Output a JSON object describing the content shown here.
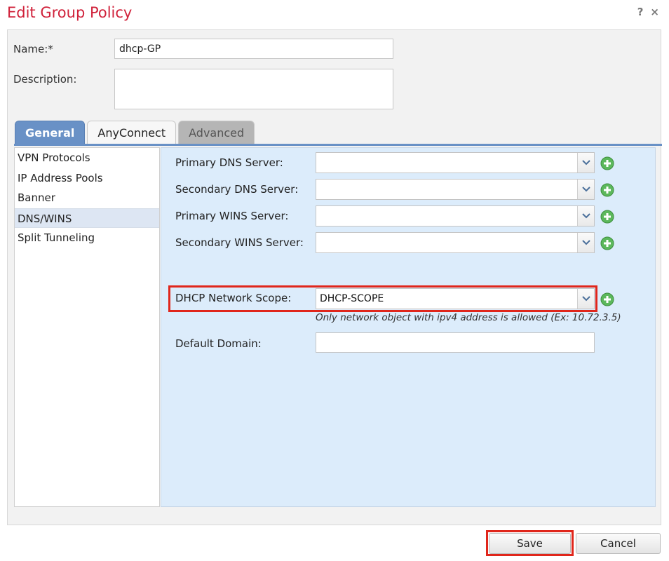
{
  "dialog": {
    "title": "Edit Group Policy",
    "help_glyph": "?",
    "close_glyph": "×"
  },
  "form": {
    "name_label": "Name:*",
    "name_value": "dhcp-GP",
    "description_label": "Description:",
    "description_value": ""
  },
  "tabs": [
    {
      "label": "General",
      "state": "active"
    },
    {
      "label": "AnyConnect",
      "state": "inactive"
    },
    {
      "label": "Advanced",
      "state": "disabled"
    }
  ],
  "nav": {
    "items": [
      "VPN Protocols",
      "IP Address Pools",
      "Banner",
      "DNS/WINS",
      "Split Tunneling"
    ],
    "selected": "DNS/WINS"
  },
  "dns": {
    "primary_dns_label": "Primary DNS Server:",
    "primary_dns_value": "",
    "secondary_dns_label": "Secondary DNS Server:",
    "secondary_dns_value": "",
    "primary_wins_label": "Primary WINS Server:",
    "primary_wins_value": "",
    "secondary_wins_label": "Secondary WINS Server:",
    "secondary_wins_value": "",
    "dhcp_scope_label": "DHCP Network Scope:",
    "dhcp_scope_value": "DHCP-SCOPE",
    "dhcp_hint": "Only network object with ipv4 address is allowed (Ex: 10.72.3.5)",
    "default_domain_label": "Default Domain:",
    "default_domain_value": ""
  },
  "buttons": {
    "save_label": "Save",
    "cancel_label": "Cancel"
  },
  "icons": {
    "add": "add-circle-icon",
    "dropdown": "chevron-down-icon",
    "help": "help-icon",
    "close": "close-icon"
  },
  "colors": {
    "title": "#d0213a",
    "tab_active": "#6991c6",
    "content_bg": "#dcecfb",
    "highlight": "#e0261b",
    "add_icon": "#5cb85c"
  }
}
